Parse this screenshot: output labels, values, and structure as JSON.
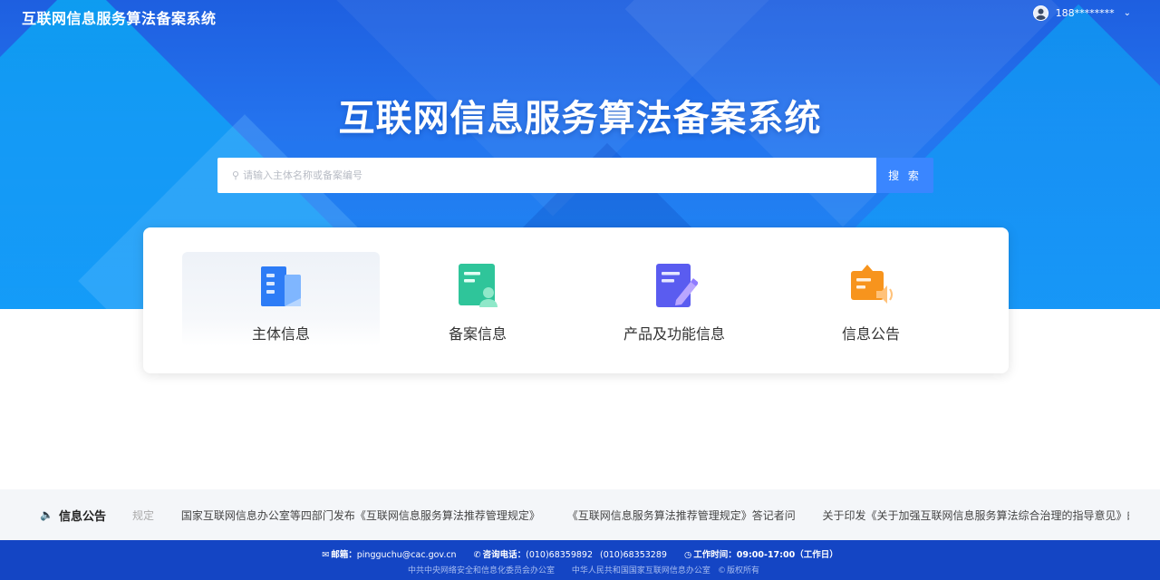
{
  "header": {
    "app_title": "互联网信息服务算法备案系统",
    "username": "188********"
  },
  "hero": {
    "title": "互联网信息服务算法备案系统"
  },
  "search": {
    "placeholder": "请输入主体名称或备案编号",
    "button_label": "搜 索"
  },
  "quick_links": [
    {
      "label": "主体信息",
      "icon": "building-icon",
      "active": true
    },
    {
      "label": "备案信息",
      "icon": "record-document-icon",
      "active": false
    },
    {
      "label": "产品及功能信息",
      "icon": "edit-document-icon",
      "active": false
    },
    {
      "label": "信息公告",
      "icon": "announcement-icon",
      "active": false
    }
  ],
  "notice": {
    "title": "信息公告",
    "items": [
      "规定",
      "国家互联网信息办公室等四部门发布《互联网信息服务算法推荐管理规定》",
      "《互联网信息服务算法推荐管理规定》答记者问",
      "关于印发《关于加强互联网信息服务算法综合治理的指导意见》的通知"
    ]
  },
  "footer": {
    "email_label": "邮箱：",
    "email": "pingguchu@cac.gov.cn",
    "phone_label": "咨询电话：",
    "phone1": "(010)68359892",
    "phone2": "(010)68353289",
    "hours_label": "工作时间：",
    "hours": "09:00-17:00（工作日）",
    "org1": "中共中央网络安全和信息化委员会办公室",
    "org2": "中华人民共和国国家互联网信息办公室",
    "copyright": "版权所有"
  },
  "colors": {
    "hero_blue": "#1e5fe0",
    "search_button": "#3a86ff",
    "footer_blue": "#1445c4"
  }
}
